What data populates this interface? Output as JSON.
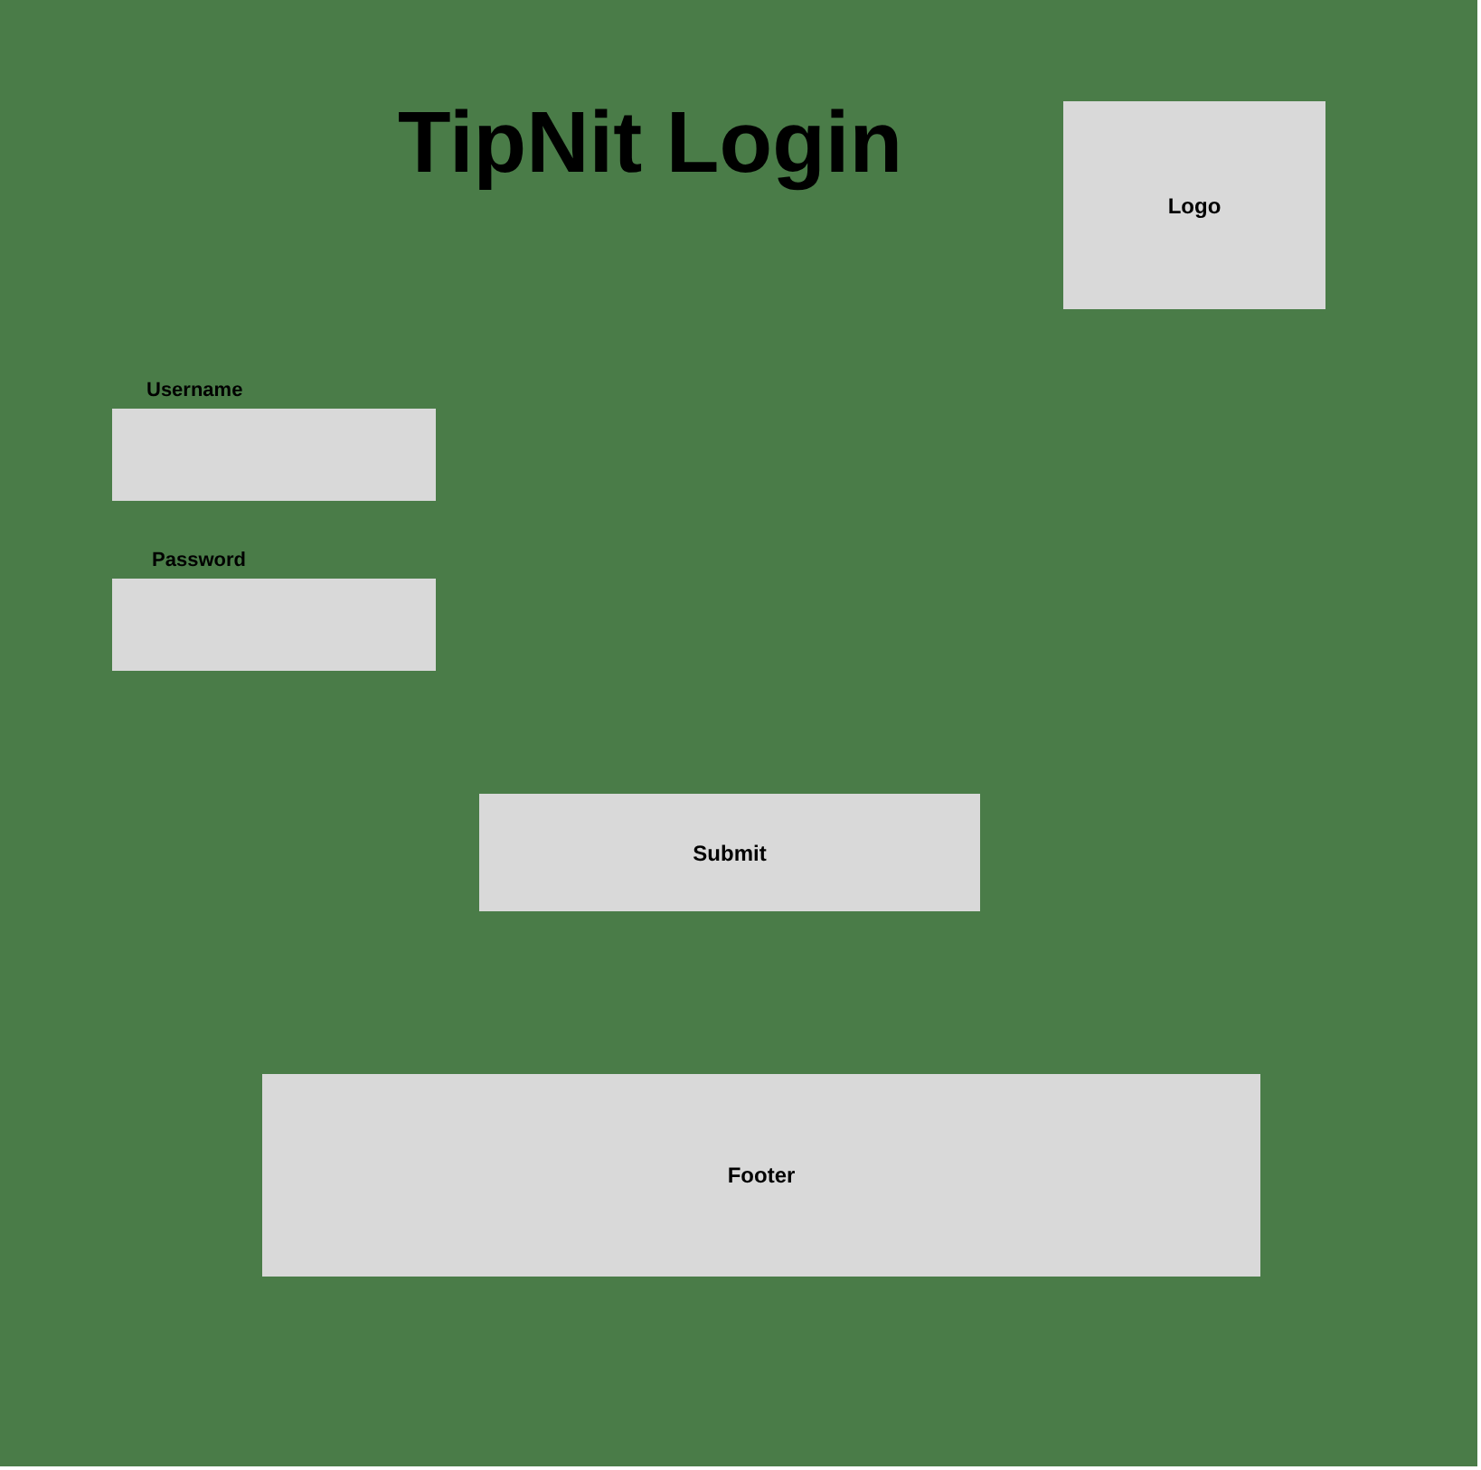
{
  "title": "TipNit Login",
  "logo": {
    "label": "Logo"
  },
  "fields": [
    {
      "label": "Username"
    },
    {
      "label": "Password"
    }
  ],
  "submit": {
    "label": "Submit"
  },
  "footer": {
    "label": "Footer"
  }
}
